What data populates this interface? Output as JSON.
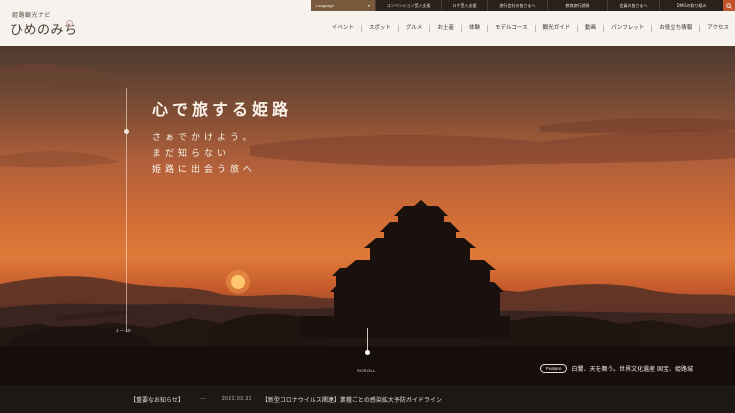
{
  "logo": {
    "subtitle": "姫路観光ナビ",
    "name": "ひめのみち"
  },
  "topbar": {
    "language": "Language",
    "links": [
      "コンベンション受入支援",
      "ロケ受入支援",
      "旅行会社の皆さまへ",
      "教育旅行誘致",
      "会員の皆さまへ",
      "DMOの取り組み"
    ]
  },
  "nav": {
    "items": [
      "イベント",
      "スポット",
      "グルメ",
      "お土産",
      "体験",
      "モデルコース",
      "観光ガイド",
      "動画",
      "パンフレット",
      "お役立ち情報",
      "アクセス"
    ]
  },
  "hero": {
    "title": "心で旅する姫路",
    "lead": [
      "さぁでかけよう。",
      "まだ知らない",
      "姫路に出会う旅へ"
    ],
    "counter": "1 — 10",
    "scroll_label": "SCROLL",
    "caption_badge": "Feature",
    "caption_text": "白鷺、天を舞う。世界文化遺産 国宝、姫路城"
  },
  "news": {
    "label": "【重要なお知らせ】",
    "dash": "—",
    "date": "2022.03.31",
    "text": "【新型コロナウイルス関連】業種ごとの感染拡大予防ガイドライン"
  },
  "colors": {
    "header_bg": "#f6f2ed",
    "topbar_bg": "#2a211c",
    "language_bg": "#7a5a3c",
    "search_bg": "#c0532b",
    "news_bg": "#1c1816"
  }
}
